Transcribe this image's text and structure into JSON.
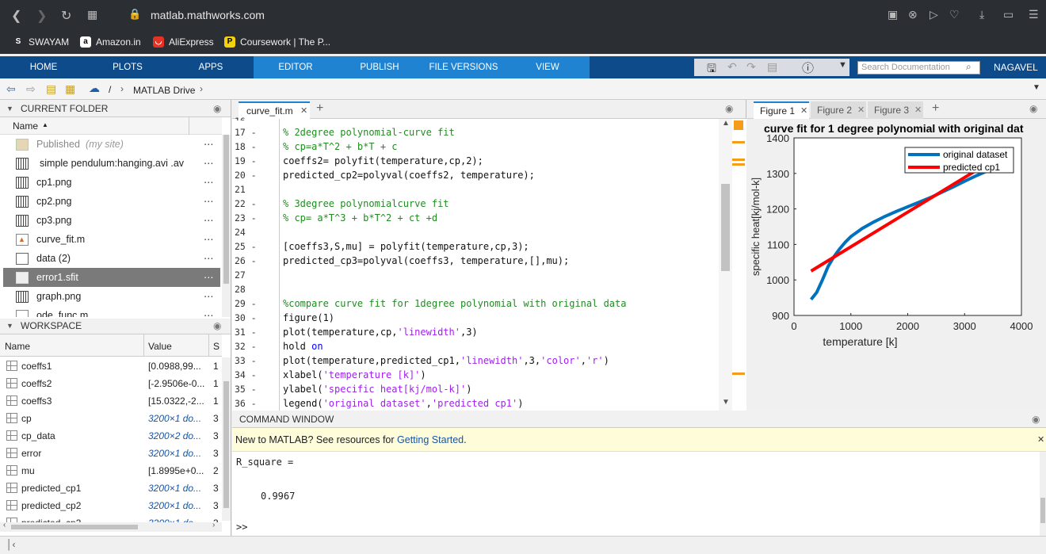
{
  "browser": {
    "url": "matlab.mathworks.com"
  },
  "bookmarks": [
    {
      "label": "SWAYAM",
      "icon": "swayam-icon"
    },
    {
      "label": "Amazon.in",
      "icon": "amazon-icon"
    },
    {
      "label": "AliExpress",
      "icon": "aliexpress-icon"
    },
    {
      "label": "Coursework | The P...",
      "icon": "coursework-icon"
    }
  ],
  "ribbon": {
    "tabs": [
      "HOME",
      "PLOTS",
      "APPS",
      "EDITOR",
      "PUBLISH",
      "FILE VERSIONS",
      "VIEW"
    ],
    "active_tab": "EDITOR",
    "search_placeholder": "Search Documentation",
    "user": "NAGAVEL"
  },
  "path": {
    "root": "/",
    "folder": "MATLAB Drive"
  },
  "current_folder": {
    "title": "CURRENT FOLDER",
    "column": "Name",
    "items": [
      {
        "name": "Published",
        "note": "(my site)",
        "icon": "folder-icon"
      },
      {
        "name": "simple pendulum:hanging.avi .av",
        "icon": "file-icon"
      },
      {
        "name": "cp1.png",
        "icon": "image-icon"
      },
      {
        "name": "cp2.png",
        "icon": "image-icon"
      },
      {
        "name": "cp3.png",
        "icon": "image-icon"
      },
      {
        "name": "curve_fit.m",
        "icon": "mscript-icon"
      },
      {
        "name": "data (2)",
        "icon": "file-icon"
      },
      {
        "name": "error1.sfit",
        "icon": "file-icon",
        "selected": true
      },
      {
        "name": "graph.png",
        "icon": "image-icon"
      },
      {
        "name": "ode_func.m",
        "icon": "mscript-icon"
      }
    ]
  },
  "workspace": {
    "title": "WORKSPACE",
    "columns": [
      "Name",
      "Value",
      "S"
    ],
    "rows": [
      {
        "name": "coeffs1",
        "value": "[0.0988,99...",
        "size": "1",
        "italic": false
      },
      {
        "name": "coeffs2",
        "value": "[-2.9506e-0...",
        "size": "1",
        "italic": false
      },
      {
        "name": "coeffs3",
        "value": "[15.0322,-2...",
        "size": "1",
        "italic": false
      },
      {
        "name": "cp",
        "value": "3200×1 do...",
        "size": "3",
        "italic": true
      },
      {
        "name": "cp_data",
        "value": "3200×2 do...",
        "size": "3",
        "italic": true
      },
      {
        "name": "error",
        "value": "3200×1 do...",
        "size": "3",
        "italic": true
      },
      {
        "name": "mu",
        "value": "[1.8995e+0...",
        "size": "2",
        "italic": false
      },
      {
        "name": "predicted_cp1",
        "value": "3200×1 do...",
        "size": "3",
        "italic": true
      },
      {
        "name": "predicted_cp2",
        "value": "3200×1 do...",
        "size": "3",
        "italic": true
      },
      {
        "name": "predicted_cp3",
        "value": "3200×1 do...",
        "size": "3",
        "italic": true
      }
    ]
  },
  "editor": {
    "tab": "curve_fit.m",
    "lines": [
      {
        "n": "17",
        "code": "% 2degree polynomial-curve fit",
        "type": "comment"
      },
      {
        "n": "18",
        "code": "% cp=a*T^2 + b*T + c",
        "type": "comment"
      },
      {
        "n": "19",
        "code": "coeffs2= polyfit(temperature,cp,2);",
        "type": "code"
      },
      {
        "n": "20",
        "code": "predicted_cp2=polyval(coeffs2, temperature);",
        "type": "code"
      },
      {
        "n": "21",
        "code": "",
        "type": "code"
      },
      {
        "n": "22",
        "code": "% 3degree polynomialcurve fit",
        "type": "comment"
      },
      {
        "n": "23",
        "code": "% cp= a*T^3 + b*T^2 + ct +d",
        "type": "comment"
      },
      {
        "n": "24",
        "code": "",
        "type": "code"
      },
      {
        "n": "25",
        "code": "[coeffs3,S,mu] = polyfit(temperature,cp,3);",
        "type": "code"
      },
      {
        "n": "26",
        "code": "predicted_cp3=polyval(coeffs3, temperature,[],mu);",
        "type": "code"
      },
      {
        "n": "27",
        "code": "",
        "type": "code"
      },
      {
        "n": "28",
        "code": "",
        "type": "code"
      },
      {
        "n": "29",
        "code": "%compare curve fit for 1degree polynomial with original data",
        "type": "comment"
      },
      {
        "n": "30",
        "code": "figure(1)",
        "type": "code"
      },
      {
        "n": "31",
        "pre": "plot(temperature,cp,",
        "str": "'linewidth'",
        "post": ",3)",
        "type": "mixed"
      },
      {
        "n": "32",
        "pre": "hold ",
        "kw": "on",
        "type": "kw"
      },
      {
        "n": "33",
        "pre": "plot(temperature,predicted_cp1,",
        "str": "'linewidth'",
        "mid": ",3,",
        "str2": "'color'",
        "mid2": ",",
        "str3": "'r'",
        "post": ")",
        "type": "mixed3"
      },
      {
        "n": "34",
        "pre": "xlabel(",
        "str": "'temperature [k]'",
        "post": ")",
        "type": "mixed"
      },
      {
        "n": "35",
        "pre": "ylabel(",
        "str": "'specific heat[kj/mol-k]'",
        "post": ")",
        "type": "mixed"
      },
      {
        "n": "36",
        "pre": "legend(",
        "str": "'original dataset'",
        "mid": ",",
        "str2": "'predicted cp1'",
        "post": ")",
        "type": "mixed2"
      }
    ]
  },
  "figures": {
    "tabs": [
      "Figure 1",
      "Figure 2",
      "Figure 3"
    ],
    "active": "Figure 1"
  },
  "chart_data": {
    "type": "line",
    "title": "curve fit for 1 degree polynomial with original dat",
    "xlabel": "temperature [k]",
    "ylabel": "specific heat[kj/mol-k]",
    "xlim": [
      0,
      4000
    ],
    "ylim": [
      900,
      1400
    ],
    "xticks": [
      0,
      1000,
      2000,
      3000,
      4000
    ],
    "yticks": [
      900,
      1000,
      1100,
      1200,
      1300,
      1400
    ],
    "legend_position": "top-right",
    "series": [
      {
        "name": "original dataset",
        "color": "#0072bd",
        "x": [
          300,
          400,
          500,
          600,
          700,
          800,
          900,
          1000,
          1200,
          1400,
          1600,
          1800,
          2000,
          2200,
          2400,
          2600,
          2800,
          3000,
          3200,
          3500
        ],
        "y": [
          945,
          965,
          1000,
          1038,
          1065,
          1087,
          1106,
          1122,
          1145,
          1163,
          1179,
          1193,
          1206,
          1219,
          1232,
          1247,
          1262,
          1278,
          1293,
          1314
        ]
      },
      {
        "name": "predicted cp1",
        "color": "#ff0000",
        "x": [
          300,
          3200
        ],
        "y": [
          1025,
          1308
        ]
      }
    ]
  },
  "command_window": {
    "title": "COMMAND WINDOW",
    "notice": "New to MATLAB? See resources for ",
    "notice_link": "Getting Started",
    "notice_end": ".",
    "output_label": "R_square =",
    "output_value": "0.9967",
    "prompt": ">>"
  }
}
